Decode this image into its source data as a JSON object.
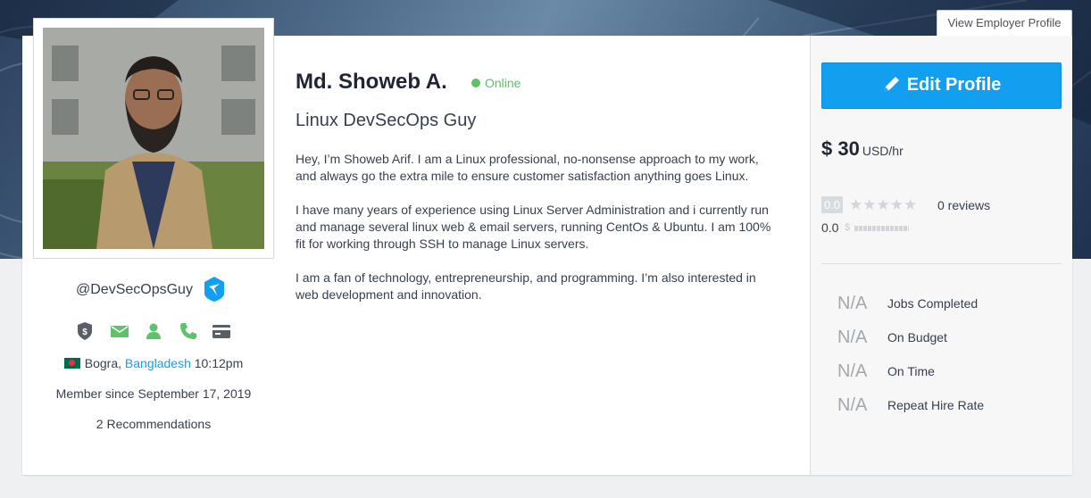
{
  "header": {
    "view_employer_label": "View Employer Profile"
  },
  "profile": {
    "username": "@DevSecOpsGuy",
    "name": "Md. Showeb A.",
    "status": "Online",
    "tagline": "Linux DevSecOps Guy",
    "about": [
      "Hey, I’m Showeb Arif. I am a Linux professional, no-nonsense approach to my work, and always go the extra mile to ensure customer satisfaction anything goes Linux.",
      "I have many years of experience using Linux Server Administration and i currently run and manage several linux web & email servers, running CentOs & Ubuntu. I am 100% fit for working through SSH to manage Linux servers.",
      "I am a fan of technology, entrepreneurship, and programming. I’m also interested in web development and innovation."
    ],
    "location": {
      "city": "Bogra,",
      "country": "Bangladesh",
      "local_time": "10:12pm"
    },
    "member_since": "Member since September 17, 2019",
    "recommendations": "2 Recommendations",
    "verifications": [
      "payment-verified-icon",
      "email-verified-icon",
      "profile-verified-icon",
      "phone-verified-icon",
      "deposit-made-icon"
    ]
  },
  "sidebar": {
    "edit_profile_label": "Edit Profile",
    "rate": "$ 30",
    "rate_unit": "USD/hr",
    "rating_box": "0.0",
    "stars": "★★★★★",
    "reviews": "0 reviews",
    "rating_score": "0.0",
    "dollar_sign": "$",
    "stats": [
      {
        "value": "N/A",
        "label": "Jobs Completed"
      },
      {
        "value": "N/A",
        "label": "On Budget"
      },
      {
        "value": "N/A",
        "label": "On Time"
      },
      {
        "value": "N/A",
        "label": "Repeat Hire Rate"
      }
    ]
  },
  "colors": {
    "accent": "#139ff0",
    "online": "#5dc26a",
    "verified": "#5dc26a"
  }
}
